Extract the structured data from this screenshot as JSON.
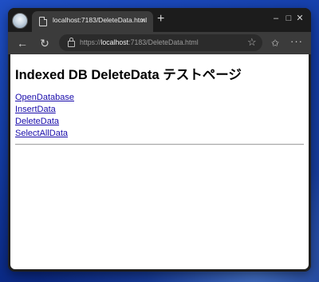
{
  "tab": {
    "title": "localhost:7183/DeleteData.html",
    "close_glyph": "×",
    "new_tab_glyph": "+"
  },
  "window_controls": {
    "minimize": "–",
    "maximize": "□",
    "close": "✕"
  },
  "nav": {
    "back_glyph": "←",
    "reload_glyph": "↻",
    "star_glyph": "☆",
    "favorites_glyph": "✩",
    "more_glyph": "···"
  },
  "address": {
    "scheme": "https://",
    "host": "localhost",
    "rest": ":7183/DeleteData.html"
  },
  "page": {
    "title": "Indexed DB DeleteData テストページ",
    "links": [
      "OpenDatabase",
      "InsertData",
      "DeleteData",
      "SelectAllData"
    ]
  },
  "colors": {
    "link": "#1a0dab",
    "titlebar": "#1c1c1c",
    "toolbar": "#3b3b3b",
    "desktop": "#143ea8"
  },
  "icons": [
    "browser-profile-icon",
    "page-document-icon",
    "lock-icon",
    "star-icon",
    "favorites-icon",
    "more-icon"
  ]
}
